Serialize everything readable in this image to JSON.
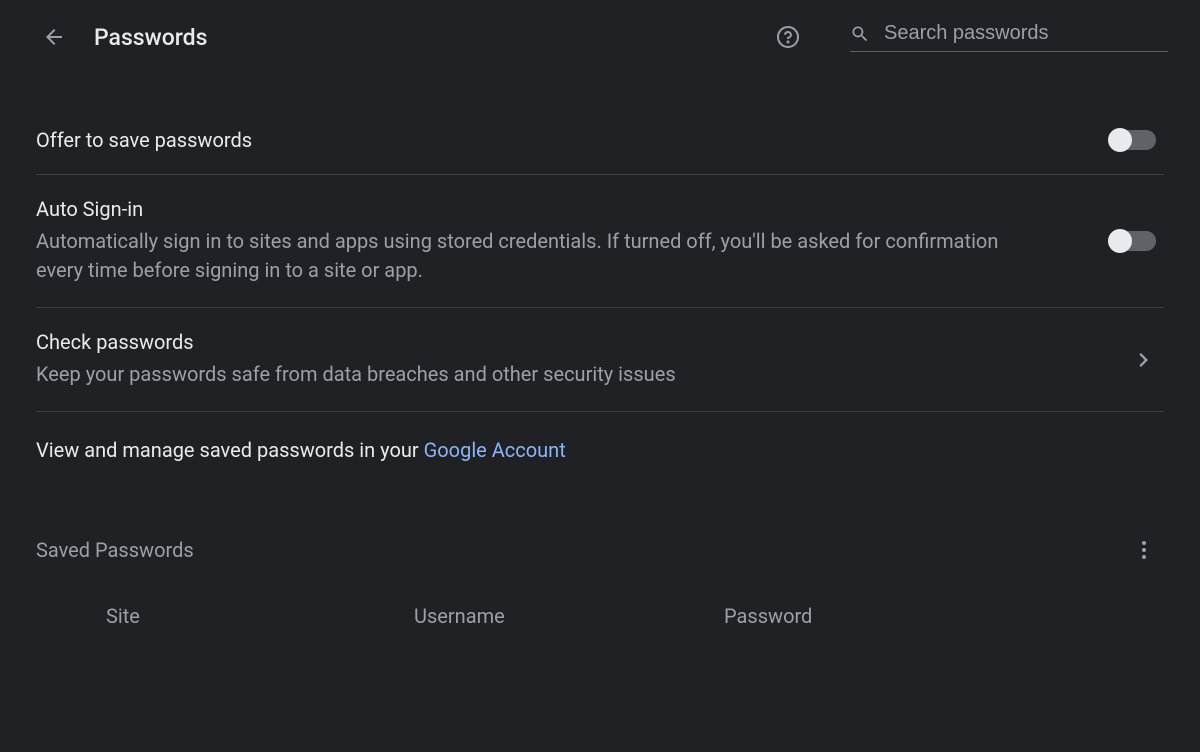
{
  "header": {
    "title": "Passwords",
    "search_placeholder": "Search passwords"
  },
  "settings": {
    "offer_save": {
      "title": "Offer to save passwords"
    },
    "auto_signin": {
      "title": "Auto Sign-in",
      "description": "Automatically sign in to sites and apps using stored credentials. If turned off, you'll be asked for confirmation every time before signing in to a site or app."
    },
    "check_passwords": {
      "title": "Check passwords",
      "description": "Keep your passwords safe from data breaches and other security issues"
    },
    "manage_link": {
      "prefix": "View and manage saved passwords in your ",
      "link_text": "Google Account"
    }
  },
  "saved_section": {
    "title": "Saved Passwords",
    "columns": {
      "site": "Site",
      "username": "Username",
      "password": "Password"
    }
  }
}
